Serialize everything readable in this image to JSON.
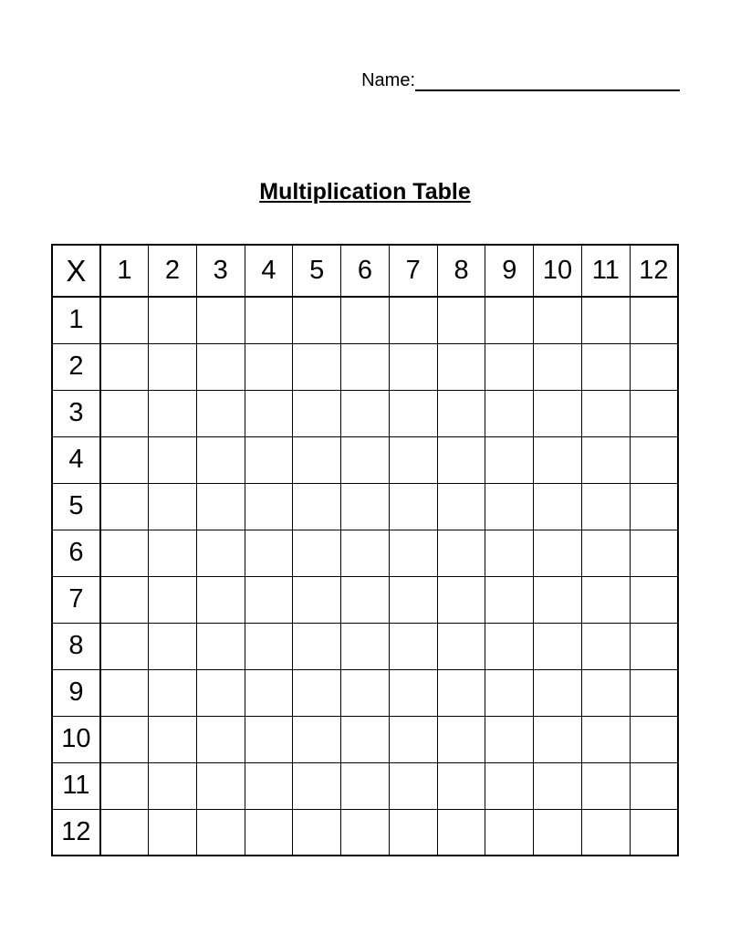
{
  "header": {
    "name_label": "Name:",
    "name_value": ""
  },
  "title": "Multiplication Table",
  "table": {
    "corner": "X",
    "col_headers": [
      "1",
      "2",
      "3",
      "4",
      "5",
      "6",
      "7",
      "8",
      "9",
      "10",
      "11",
      "12"
    ],
    "row_headers": [
      "1",
      "2",
      "3",
      "4",
      "5",
      "6",
      "7",
      "8",
      "9",
      "10",
      "11",
      "12"
    ],
    "cells": [
      [
        "",
        "",
        "",
        "",
        "",
        "",
        "",
        "",
        "",
        "",
        "",
        ""
      ],
      [
        "",
        "",
        "",
        "",
        "",
        "",
        "",
        "",
        "",
        "",
        "",
        ""
      ],
      [
        "",
        "",
        "",
        "",
        "",
        "",
        "",
        "",
        "",
        "",
        "",
        ""
      ],
      [
        "",
        "",
        "",
        "",
        "",
        "",
        "",
        "",
        "",
        "",
        "",
        ""
      ],
      [
        "",
        "",
        "",
        "",
        "",
        "",
        "",
        "",
        "",
        "",
        "",
        ""
      ],
      [
        "",
        "",
        "",
        "",
        "",
        "",
        "",
        "",
        "",
        "",
        "",
        ""
      ],
      [
        "",
        "",
        "",
        "",
        "",
        "",
        "",
        "",
        "",
        "",
        "",
        ""
      ],
      [
        "",
        "",
        "",
        "",
        "",
        "",
        "",
        "",
        "",
        "",
        "",
        ""
      ],
      [
        "",
        "",
        "",
        "",
        "",
        "",
        "",
        "",
        "",
        "",
        "",
        ""
      ],
      [
        "",
        "",
        "",
        "",
        "",
        "",
        "",
        "",
        "",
        "",
        "",
        ""
      ],
      [
        "",
        "",
        "",
        "",
        "",
        "",
        "",
        "",
        "",
        "",
        "",
        ""
      ],
      [
        "",
        "",
        "",
        "",
        "",
        "",
        "",
        "",
        "",
        "",
        "",
        ""
      ]
    ]
  }
}
